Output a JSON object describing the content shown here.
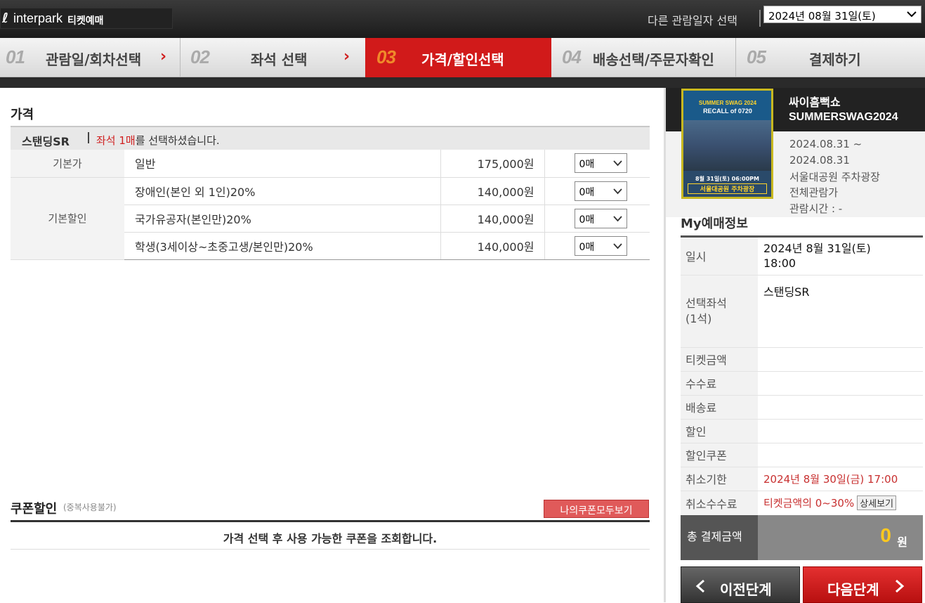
{
  "header": {
    "logo_mark": "ℓ",
    "logo_word": "interpark",
    "logo_sub": "티켓예매",
    "date_label": "다른 관람일자 선택",
    "date_selected": "2024년 08월 31일(토)"
  },
  "steps": [
    {
      "num": "01",
      "label": "관람일/회차선택",
      "arrow": "›"
    },
    {
      "num": "02",
      "label": "좌석 선택",
      "arrow": "›"
    },
    {
      "num": "03",
      "label": "가격/할인선택"
    },
    {
      "num": "04",
      "label": "배송선택/주문자확인"
    },
    {
      "num": "05",
      "label": "결제하기"
    }
  ],
  "price": {
    "title": "가격",
    "grade": "스탠딩SR",
    "msg_pre": "좌석 ",
    "msg_count": "1매",
    "msg_post": "를 선택하셨습니다.",
    "cat_base": "기본가",
    "cat_discount": "기본할인",
    "rows": [
      {
        "name": "일반",
        "amount": "175,000원",
        "qty": "0매"
      },
      {
        "name": "장애인(본인 외 1인)20%",
        "amount": "140,000원",
        "qty": "0매"
      },
      {
        "name": "국가유공자(본인만)20%",
        "amount": "140,000원",
        "qty": "0매"
      },
      {
        "name": "학생(3세이상~초중고생/본인만)20%",
        "amount": "140,000원",
        "qty": "0매"
      }
    ]
  },
  "coupon": {
    "title": "쿠폰할인",
    "note": "(중복사용불가)",
    "button": "나의쿠폰모두보기",
    "message": "가격 선택 후 사용 가능한 쿠폰을 조회합니다."
  },
  "show": {
    "title1": "싸이흠뻑쇼",
    "title2": "SUMMERSWAG2024",
    "period1": "2024.08.31 ~",
    "period2": "2024.08.31",
    "venue": "서울대공원 주차광장",
    "rating": "전체관람가",
    "runtime": "관람시간 : -",
    "poster_t1": "SUMMER SWAG 2024",
    "poster_t2": "RECALL of 0720",
    "poster_t3": "8월 31일(토) 06:00PM",
    "poster_t4": "서울대공원 주차광장"
  },
  "my": {
    "title": "My예매정보",
    "date_label": "일시",
    "date_value": "2024년 8월 31일(토)",
    "time_value": "18:00",
    "seat_label": "선택좌석",
    "seat_count": "(1석)",
    "seat_value": "스탠딩SR",
    "ticket_label": "티켓금액",
    "fee_label": "수수료",
    "delivery_label": "배송료",
    "discount_label": "할인",
    "coupon_label": "할인쿠폰",
    "cancel_deadline_label": "취소기한",
    "cancel_deadline_value": "2024년 8월 30일(금) 17:00",
    "cancel_fee_label": "취소수수료",
    "cancel_fee_value": "티켓금액의 0~30%",
    "detail_button": "상세보기",
    "total_label": "총 결제금액",
    "total_value": "0",
    "total_unit": "원"
  },
  "nav": {
    "prev": "이전단계",
    "next": "다음단계"
  }
}
